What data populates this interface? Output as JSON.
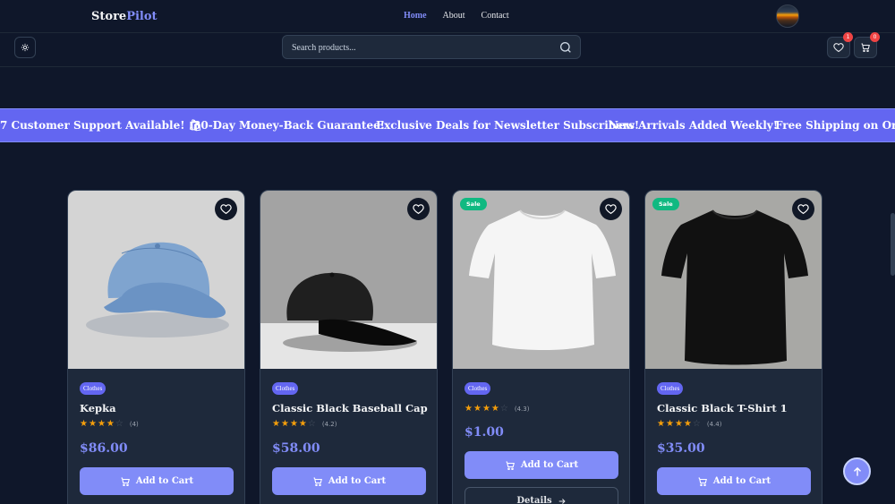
{
  "brand": {
    "first": "Store",
    "second": "Pilot",
    "accent": "#818cf8"
  },
  "nav": {
    "links": [
      {
        "label": "Home",
        "active": true
      },
      {
        "label": "About",
        "active": false
      },
      {
        "label": "Contact",
        "active": false
      }
    ]
  },
  "toolbar": {
    "theme_icon": "sun-icon",
    "search_placeholder": "Search products...",
    "wishlist_count": "1",
    "cart_count": "0"
  },
  "marquee": {
    "items": [
      "7 Customer Support Available! 🛍",
      "30-Day Money-Back Guarantee!",
      "Exclusive Deals for Newsletter Subscribers!",
      "New Arrivals Added Weekly!",
      "Free Shipping on Orders"
    ]
  },
  "products": [
    {
      "category": "Clothes",
      "title": "Kepka",
      "rating_value": 4,
      "rating_text": "(4)",
      "price": "$86.00",
      "sale": false,
      "sale_label": "",
      "image": "blue-cap",
      "cart_label": "Add to Cart",
      "details_label": ""
    },
    {
      "category": "Clothes",
      "title": "Classic Black Baseball Cap",
      "rating_value": 4.2,
      "rating_text": "(4.2)",
      "price": "$58.00",
      "sale": false,
      "sale_label": "",
      "image": "black-cap",
      "cart_label": "Add to Cart",
      "details_label": ""
    },
    {
      "category": "Clothes",
      "title": "",
      "rating_value": 4.3,
      "rating_text": "(4.3)",
      "price": "$1.00",
      "sale": true,
      "sale_label": "Sale",
      "image": "white-tshirt",
      "cart_label": "Add to Cart",
      "details_label": "Details"
    },
    {
      "category": "Clothes",
      "title": "Classic Black T-Shirt 1",
      "rating_value": 4.4,
      "rating_text": "(4.4)",
      "price": "$35.00",
      "sale": true,
      "sale_label": "Sale",
      "image": "black-tshirt",
      "cart_label": "Add to Cart",
      "details_label": ""
    }
  ],
  "colors": {
    "background": "#0f172a",
    "card": "#1e293b",
    "primary": "#818cf8",
    "marquee": "#6366f1",
    "sale": "#10b981",
    "star": "#f59e0b",
    "badge": "#ef4444"
  }
}
